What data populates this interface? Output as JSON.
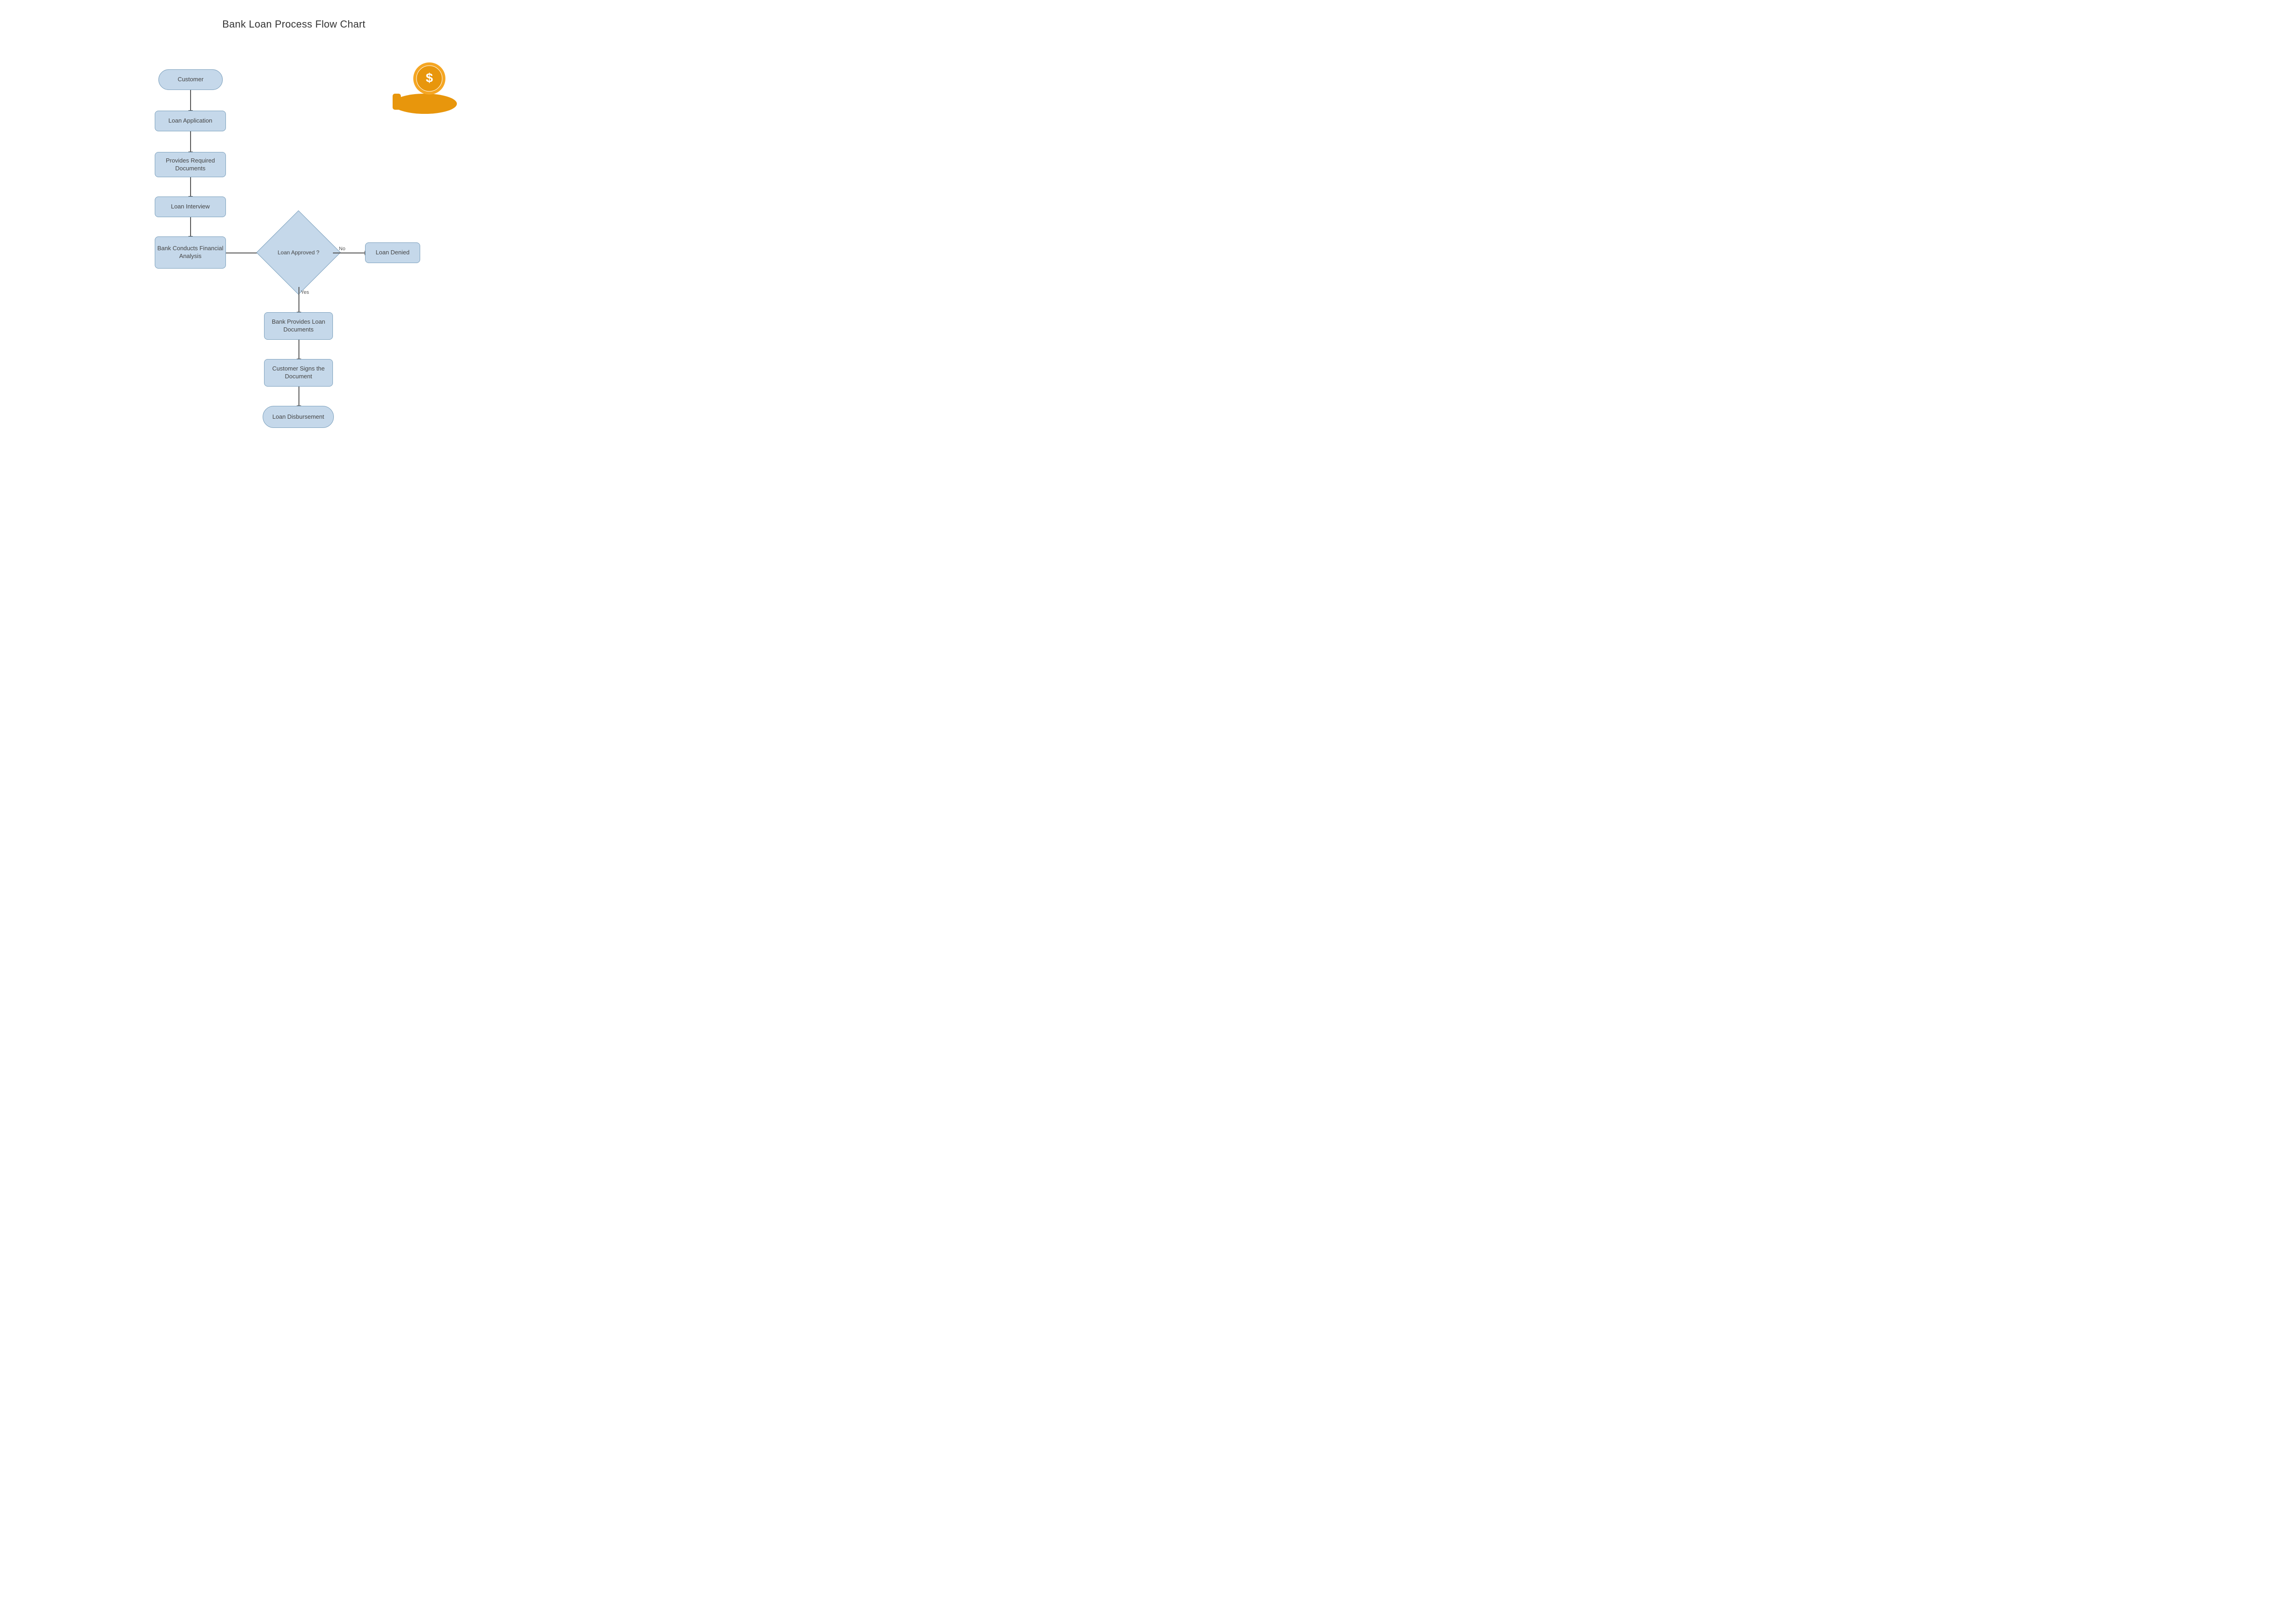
{
  "title": "Bank Loan Process Flow Chart",
  "nodes": {
    "customer": {
      "label": "Customer"
    },
    "loan_application": {
      "label": "Loan Application"
    },
    "provides_docs": {
      "label": "Provides Required Documents"
    },
    "loan_interview": {
      "label": "Loan Interview"
    },
    "bank_conducts": {
      "label": "Bank Conducts Financial Analysis"
    },
    "loan_approved": {
      "label": "Loan Approved ?"
    },
    "yes_label": {
      "label": "Yes"
    },
    "no_label": {
      "label": "No"
    },
    "loan_denied": {
      "label": "Loan Denied"
    },
    "bank_provides": {
      "label": "Bank Provides Loan Documents"
    },
    "customer_signs": {
      "label": "Customer Signs the Document"
    },
    "loan_disbursement": {
      "label": "Loan Disbursement"
    }
  },
  "icon": {
    "alt": "Bank loan money hand icon"
  }
}
